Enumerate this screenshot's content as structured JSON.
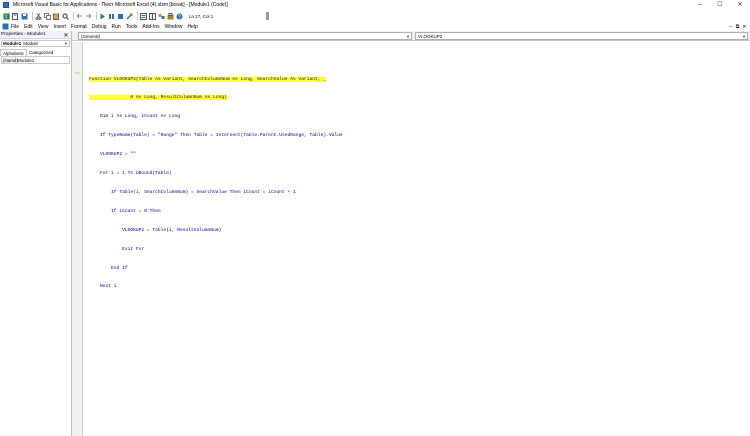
{
  "window": {
    "title": "Microsoft Visual Basic for Applications - Пwcт Microsoft Excel (4).xlsm [break] - [Module1 (Code)]",
    "controls": {
      "minimize": "–",
      "maximize": "☐",
      "close": "✕"
    }
  },
  "toolbar": {
    "position": "Ln 17, Col 1",
    "icons": [
      "excel-icon",
      "insert-icon",
      "save-icon",
      "cut-icon",
      "copy-icon",
      "paste-icon",
      "find-icon",
      "undo-icon",
      "redo-icon",
      "run-icon",
      "break-icon",
      "reset-icon",
      "design-icon",
      "project-icon",
      "properties-icon",
      "object-browser-icon",
      "toolbox-icon",
      "help-icon"
    ]
  },
  "menubar": {
    "items": [
      "File",
      "Edit",
      "View",
      "Insert",
      "Format",
      "Debug",
      "Run",
      "Tools",
      "Add-Ins",
      "Window",
      "Help"
    ],
    "controls": {
      "minimize": "–",
      "restore": "⧉",
      "close": "✕"
    }
  },
  "properties": {
    "header": "Properties - Module1",
    "object_name": "Module1",
    "object_type": "Module",
    "tabs": [
      "Alphabetic",
      "Categorized"
    ],
    "rows": [
      {
        "key": "(Name)",
        "value": "Module1"
      }
    ]
  },
  "code_window": {
    "object_combo": "(General)",
    "proc_combo": "VLOOKUP2",
    "lines": [
      "Function VLOOKUP2(Table As Variant, SearchColumnNum As Long, SearchValue As Variant, _",
      "               N As Long, ResultColumnNum As Long)",
      "    Dim i As Long, iCount As Long",
      "    If TypeName(Table) = \"Range\" Then Table = Intersect(Table.Parent.UsedRange, Table).Value",
      "    VLOOKUP2 = \"\"",
      "    For i = 1 To UBound(Table)",
      "        If Table(i, SearchColumnNum) = SearchValue Then iCount = iCount + 1",
      "        If iCount = N Then",
      "            VLOOKUP2 = Table(i, ResultColumnNum)",
      "            Exit For",
      "        End If",
      "    Next i"
    ]
  }
}
